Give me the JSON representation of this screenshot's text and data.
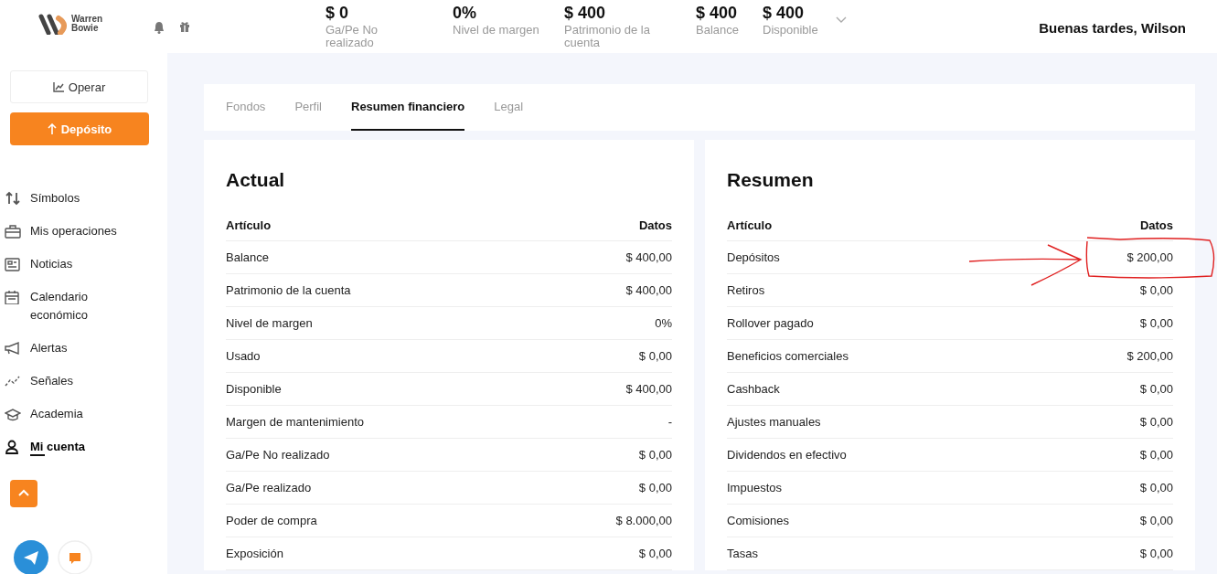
{
  "logo": {
    "line1": "Warren",
    "line2": "Bowie"
  },
  "stats": [
    {
      "value": "$ 0",
      "label": "Ga/Pe No realizado"
    },
    {
      "value": "0%",
      "label": "Nivel de margen"
    },
    {
      "value": "$ 400",
      "label": "Patrimonio de la cuenta"
    },
    {
      "value": "$ 400",
      "label": "Balance"
    },
    {
      "value": "$ 400",
      "label": "Disponible"
    }
  ],
  "greeting": "Buenas tardes, Wilson",
  "sidebar": {
    "operate_button": "Operar",
    "deposit_button": "Depósito",
    "items": [
      {
        "label": "Símbolos",
        "selected": false
      },
      {
        "label": "Mis operaciones",
        "selected": false
      },
      {
        "label": "Noticias",
        "selected": false
      },
      {
        "label": "Calendario económico",
        "selected": false
      },
      {
        "label": "Alertas",
        "selected": false
      },
      {
        "label": "Señales",
        "selected": false
      },
      {
        "label": "Academia",
        "selected": false
      },
      {
        "label": "Mi cuenta",
        "selected": true
      }
    ]
  },
  "tabs": [
    {
      "label": "Fondos",
      "selected": false
    },
    {
      "label": "Perfil",
      "selected": false
    },
    {
      "label": "Resumen financiero",
      "selected": true
    },
    {
      "label": "Legal",
      "selected": false
    }
  ],
  "cards": [
    {
      "title": "Actual",
      "columns": [
        "Artículo",
        "Datos"
      ],
      "rows": [
        [
          "Balance",
          "$ 400,00"
        ],
        [
          "Patrimonio de la cuenta",
          "$ 400,00"
        ],
        [
          "Nivel de margen",
          "0%"
        ],
        [
          "Usado",
          "$ 0,00"
        ],
        [
          "Disponible",
          "$ 400,00"
        ],
        [
          "Margen de mantenimiento",
          "-"
        ],
        [
          "Ga/Pe No realizado",
          "$ 0,00"
        ],
        [
          "Ga/Pe realizado",
          "$ 0,00"
        ],
        [
          "Poder de compra",
          "$ 8.000,00"
        ],
        [
          "Exposición",
          "$ 0,00"
        ]
      ]
    },
    {
      "title": "Resumen",
      "columns": [
        "Artículo",
        "Datos"
      ],
      "rows": [
        [
          "Depósitos",
          "$ 200,00"
        ],
        [
          "Retiros",
          "$ 0,00"
        ],
        [
          "Rollover pagado",
          "$ 0,00"
        ],
        [
          "Beneficios comerciales",
          "$ 200,00"
        ],
        [
          "Cashback",
          "$ 0,00"
        ],
        [
          "Ajustes manuales",
          "$ 0,00"
        ],
        [
          "Dividendos en efectivo",
          "$ 0,00"
        ],
        [
          "Impuestos",
          "$ 0,00"
        ],
        [
          "Comisiones",
          "$ 0,00"
        ],
        [
          "Tasas",
          "$ 0,00"
        ]
      ]
    }
  ]
}
